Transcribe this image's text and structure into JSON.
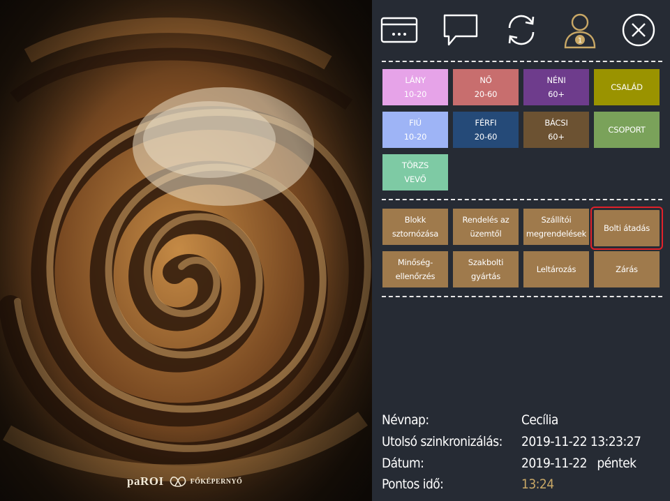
{
  "brand": {
    "name": "paROI",
    "screen": "FŐKÉPERNYŐ"
  },
  "toolbar": {
    "icons": [
      "card-icon",
      "chat-icon",
      "sync-icon",
      "user-icon",
      "close-icon"
    ],
    "user_badge": "1"
  },
  "customer_tiles": [
    {
      "line1": "LÁNY",
      "line2": "10-20",
      "color": "#e6a3e8"
    },
    {
      "line1": "NŐ",
      "line2": "20-60",
      "color": "#c86e6e"
    },
    {
      "line1": "NÉNI",
      "line2": "60+",
      "color": "#6e3c8c"
    },
    {
      "line1": "CSALÁD",
      "line2": "",
      "color": "#9a9300"
    },
    {
      "line1": "FIÚ",
      "line2": "10-20",
      "color": "#9eb4f6"
    },
    {
      "line1": "FÉRFI",
      "line2": "20-60",
      "color": "#254a78"
    },
    {
      "line1": "BÁCSI",
      "line2": "60+",
      "color": "#6c5232"
    },
    {
      "line1": "CSOPORT",
      "line2": "",
      "color": "#7aa25a"
    },
    {
      "line1": "TÖRZS",
      "line2": "VEVŐ",
      "color": "#7ecaa4"
    }
  ],
  "function_tiles": [
    {
      "line1": "Blokk",
      "line2": "sztornózása"
    },
    {
      "line1": "Rendelés az",
      "line2": "üzemtől"
    },
    {
      "line1": "Szállítói",
      "line2": "megrendelések"
    },
    {
      "line1": "Bolti átadás",
      "line2": ""
    },
    {
      "line1": "Minőség-",
      "line2": "ellenőrzés"
    },
    {
      "line1": "Szakbolti",
      "line2": "gyártás"
    },
    {
      "line1": "Leltározás",
      "line2": ""
    },
    {
      "line1": "Zárás",
      "line2": ""
    }
  ],
  "selected_function": "Bolti átadás",
  "info": {
    "nameday_label": "Névnap:",
    "nameday_value": "Cecília",
    "sync_label": "Utolsó szinkronizálás:",
    "sync_value": "2019-11-22 13:23:27",
    "date_label": "Dátum:",
    "date_value": "2019-11-22",
    "weekday": "péntek",
    "time_label": "Pontos idő:",
    "time_value": "13:24"
  },
  "colors": {
    "panel": "#262b34",
    "function_tile": "#9f7a4c",
    "selection": "#e0212a",
    "time": "#c9a866"
  }
}
